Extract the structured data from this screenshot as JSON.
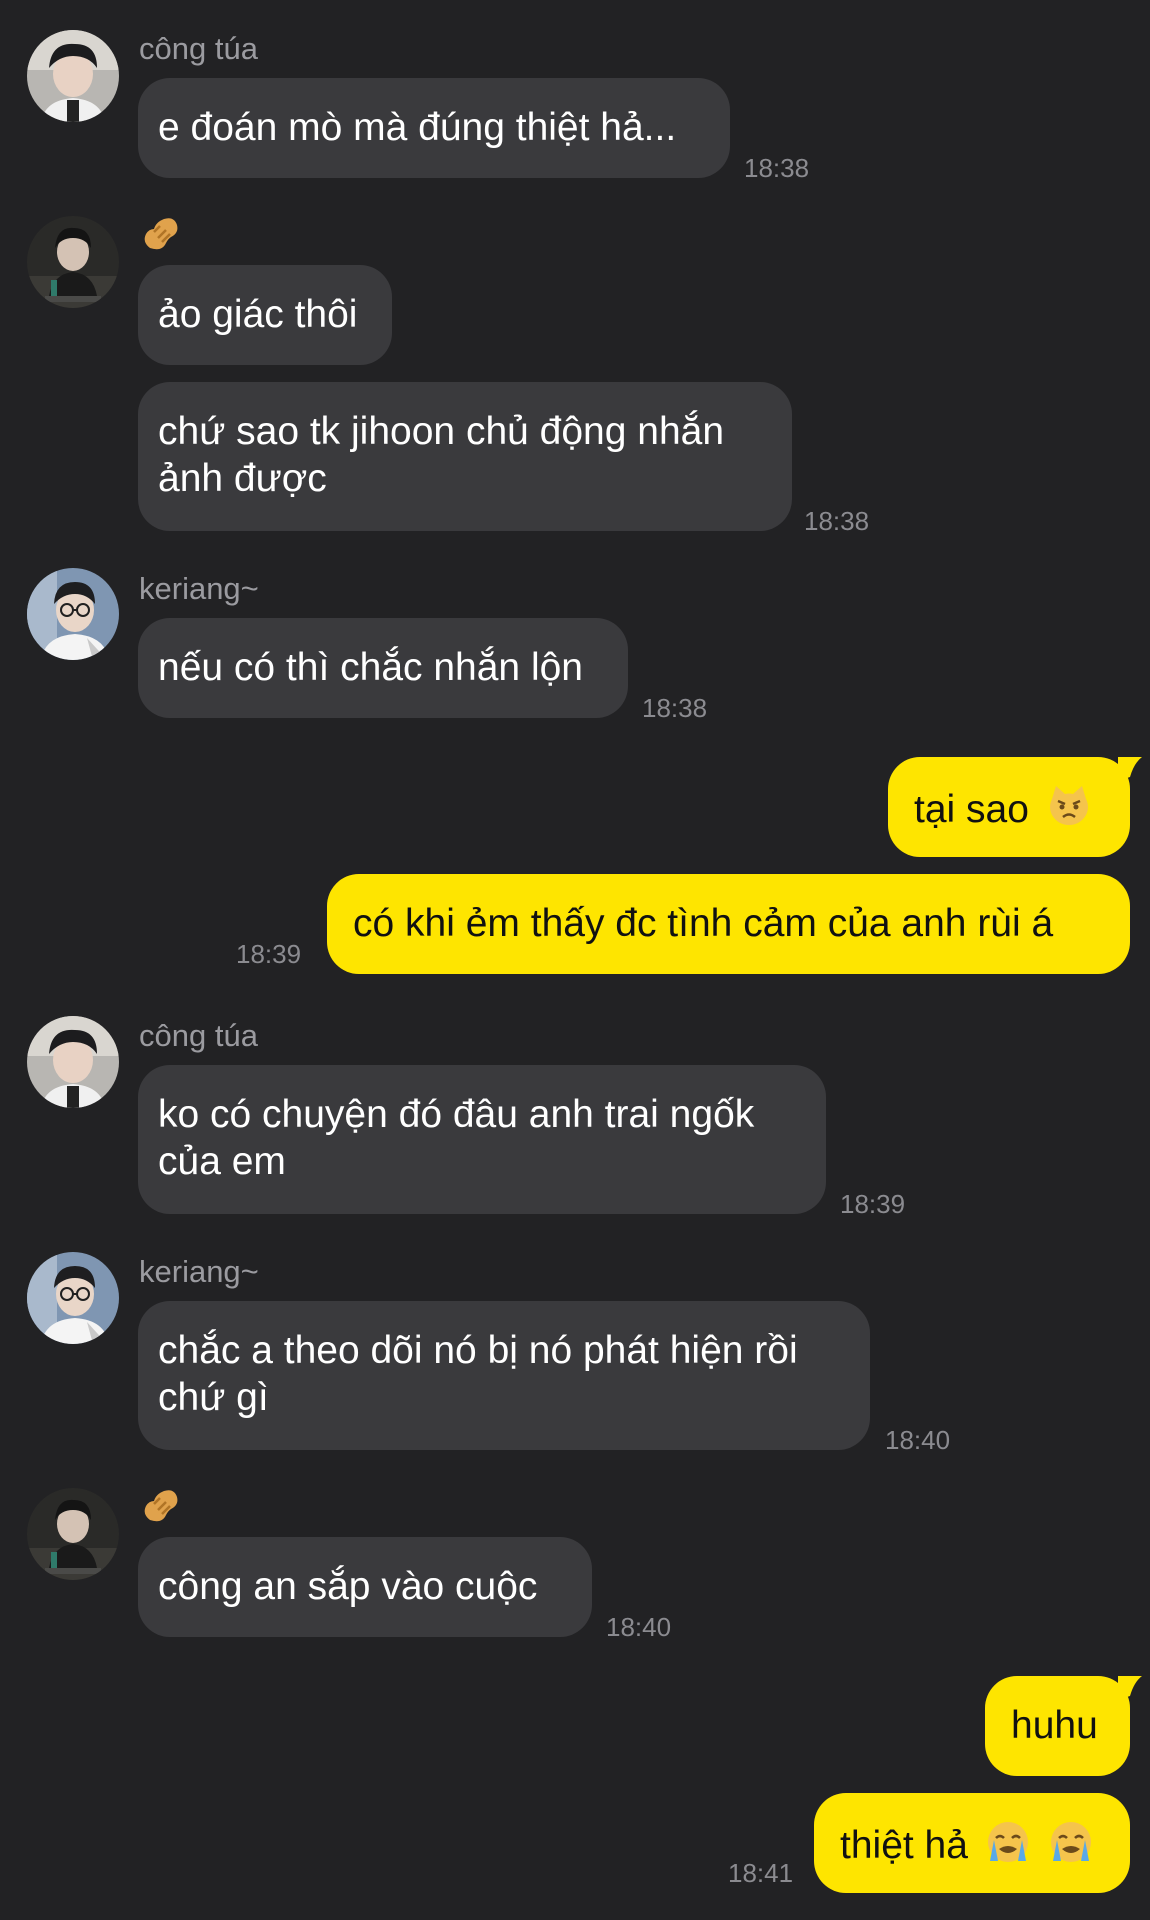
{
  "colors": {
    "background": "#222224",
    "incoming_bubble": "#3a3a3d",
    "outgoing_bubble": "#fee500",
    "name_text": "#9b9ba0",
    "time_text": "#8b8b90"
  },
  "messages": [
    {
      "sender": "công túa",
      "text": "e đoán mò mà đúng thiệt hả...",
      "time": "18:38"
    },
    {
      "sender_icon": "peanut-icon",
      "text": "ảo giác thôi"
    },
    {
      "text_line1": "chứ sao tk jihoon chủ động nhắn",
      "text_line2": "ảnh được",
      "time": "18:38"
    },
    {
      "sender": "keriang~",
      "text": "nếu có thì chắc nhắn lộn",
      "time": "18:38"
    },
    {
      "text": "tại sao",
      "emoji": "pouting-cat-face-icon"
    },
    {
      "text": "có khi ẻm thấy đc tình cảm của anh rùi á",
      "time": "18:39"
    },
    {
      "sender": "công túa",
      "text_line1": "ko có chuyện đó đâu anh trai ngốk",
      "text_line2": "của em",
      "time": "18:39"
    },
    {
      "sender": "keriang~",
      "text_line1": "chắc a theo dõi nó bị nó phát hiện rồi",
      "text_line2": "chứ gì",
      "time": "18:40"
    },
    {
      "sender_icon": "peanut-icon",
      "text": "công an sắp vào cuộc",
      "time": "18:40"
    },
    {
      "text": "huhu"
    },
    {
      "text": "thiệt hả",
      "emoji": "crying-face-icon",
      "time": "18:41"
    }
  ]
}
